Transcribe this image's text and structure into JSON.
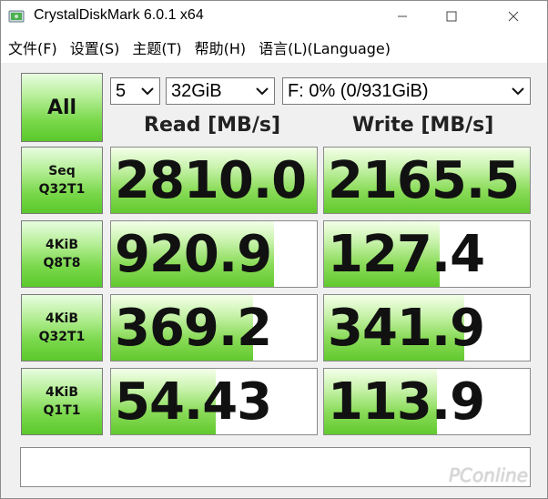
{
  "window": {
    "title": "CrystalDiskMark 6.0.1 x64",
    "icon": "crystaldiskmark-app-icon"
  },
  "menu": [
    {
      "label": "文件(F)"
    },
    {
      "label": "设置(S)"
    },
    {
      "label": "主题(T)"
    },
    {
      "label": "帮助(H)"
    },
    {
      "label": "语言(L)(Language)"
    }
  ],
  "controls": {
    "all_label": "All",
    "count_value": "5",
    "size_value": "32GiB",
    "drive_value": "F: 0% (0/931GiB)"
  },
  "headers": {
    "read": "Read [MB/s]",
    "write": "Write [MB/s]"
  },
  "tests": [
    {
      "line1": "Seq",
      "line2": "Q32T1",
      "read": "2810.0",
      "write": "2165.5",
      "read_fill": 1.0,
      "write_fill": 1.0
    },
    {
      "line1": "4KiB",
      "line2": "Q8T8",
      "read": "920.9",
      "write": "127.4",
      "read_fill": 0.79,
      "write_fill": 0.56
    },
    {
      "line1": "4KiB",
      "line2": "Q32T1",
      "read": "369.2",
      "write": "341.9",
      "read_fill": 0.69,
      "write_fill": 0.68
    },
    {
      "line1": "4KiB",
      "line2": "Q1T1",
      "read": "54.43",
      "write": "113.9",
      "read_fill": 0.51,
      "write_fill": 0.55
    }
  ],
  "status": "",
  "watermark": "PConline",
  "colors": {
    "accent_green": "#62c92e",
    "button_green": "#79d84a",
    "background": "#f0f0f0"
  }
}
